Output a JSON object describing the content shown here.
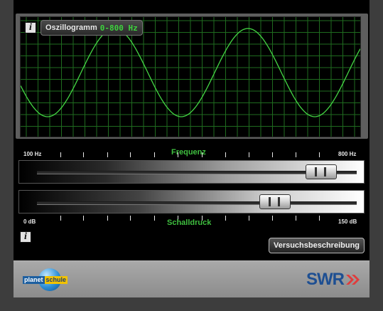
{
  "oscilloscope": {
    "title": "Oszillogramm",
    "range": "0-800 Hz",
    "info_icon": "i",
    "wave_color": "#44d644",
    "grid_color": "#1f6b1f"
  },
  "frequency": {
    "label": "Frequenz",
    "min_label": "100 Hz",
    "max_label": "800 Hz",
    "value_fraction": 0.93
  },
  "pressure": {
    "label": "Schalldruck",
    "min_label": "0 dB",
    "max_label": "150 dB",
    "value_fraction": 0.77
  },
  "info_icon": "i",
  "description_button": "Versuchsbeschreibung",
  "footer": {
    "brand_a": "planet",
    "brand_b": "schule",
    "swr": "SWR",
    "swr_arrows_color": "#e03c3c"
  }
}
